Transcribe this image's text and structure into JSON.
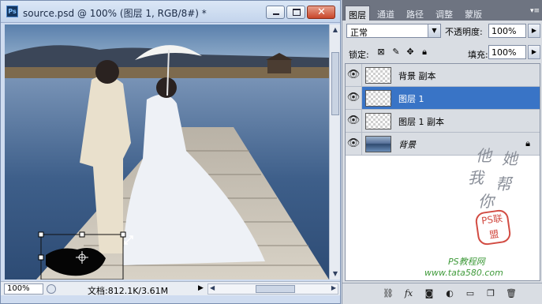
{
  "document": {
    "ps_badge": "Ps",
    "title": "source.psd @ 100% (图层 1, RGB/8#) *",
    "zoom": "100%",
    "info": "文档:812.1K/3.61M"
  },
  "panel": {
    "tabs": [
      "图层",
      "通道",
      "路径",
      "调整",
      "蒙版"
    ],
    "blend_mode": "正常",
    "opacity_label": "不透明度:",
    "opacity_value": "100%",
    "lock_label": "锁定:",
    "fill_label": "填充:",
    "fill_value": "100%",
    "layers": [
      {
        "name": "背景 副本",
        "visible": true,
        "selected": false,
        "thumb": "transparent"
      },
      {
        "name": "图层 1",
        "visible": true,
        "selected": true,
        "thumb": "transparent"
      },
      {
        "name": "图层 1 副本",
        "visible": true,
        "selected": false,
        "thumb": "transparent"
      },
      {
        "name": "背景",
        "visible": true,
        "selected": false,
        "thumb": "photo",
        "locked": true
      }
    ],
    "watermark": {
      "chars": [
        "他",
        "她",
        "我",
        "帮",
        "你"
      ],
      "seal": "PS联盟",
      "site1": "PS教程网",
      "site2": "www.tata580.com"
    },
    "bottom_icons": [
      "link-icon",
      "fx-icon",
      "mask-icon",
      "adjustment-icon",
      "group-folder-icon",
      "new-layer-icon",
      "trash-icon"
    ]
  },
  "colors": {
    "selected_layer": "#3974c6",
    "tab_bar": "#6e7481",
    "close_button": "#c8462a"
  }
}
